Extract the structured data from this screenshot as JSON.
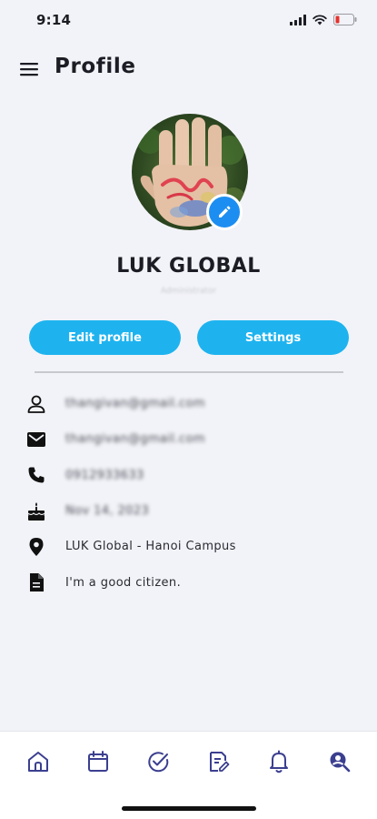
{
  "status_bar": {
    "time": "9:14",
    "battery_color": "#e5322d"
  },
  "header": {
    "title": "Profile",
    "menu_icon": "hamburger-menu-icon"
  },
  "profile": {
    "name": "LUK GLOBAL",
    "role": "Administrator",
    "avatar_icon": "hand-photo-avatar",
    "edit_avatar_icon": "pencil-icon"
  },
  "actions": {
    "edit_profile": "Edit profile",
    "settings": "Settings"
  },
  "info": [
    {
      "icon": "person-icon",
      "text": "thangivan@gmail.com",
      "blurred": true
    },
    {
      "icon": "email-icon",
      "text": "thangivan@gmail.com",
      "blurred": true
    },
    {
      "icon": "phone-icon",
      "text": "0912933633",
      "blurred": true
    },
    {
      "icon": "cake-icon",
      "text": "Nov 14, 2023",
      "blurred": true
    },
    {
      "icon": "location-pin-icon",
      "text": "LUK Global - Hanoi Campus",
      "blurred": false
    },
    {
      "icon": "document-icon",
      "text": "I'm a good citizen.",
      "blurred": false
    }
  ],
  "bottom_nav": [
    {
      "icon": "home-icon"
    },
    {
      "icon": "calendar-icon"
    },
    {
      "icon": "check-circle-icon"
    },
    {
      "icon": "edit-note-icon"
    },
    {
      "icon": "bell-icon"
    },
    {
      "icon": "profile-search-icon"
    }
  ],
  "colors": {
    "accent": "#1eb3ef",
    "edit_badge": "#1d8ef1",
    "nav_icon": "#3b3f8f"
  }
}
